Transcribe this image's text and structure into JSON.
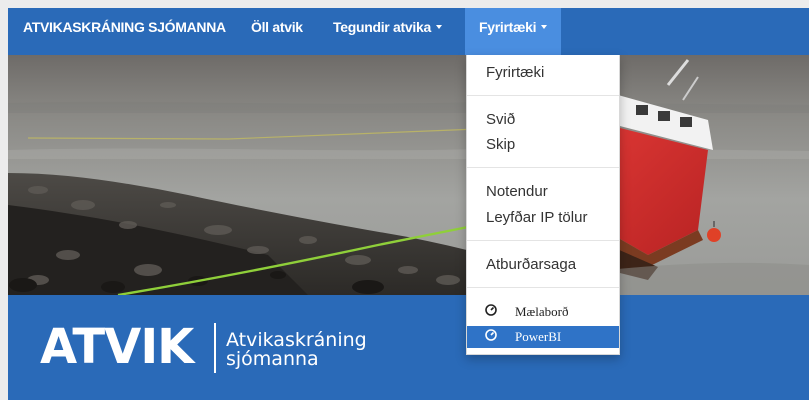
{
  "navbar": {
    "brand": "ATVIKASKRÁNING SJÓMANNA",
    "all_incidents": "Öll atvik",
    "incident_types": "Tegundir atvika",
    "companies": "Fyrirtæki"
  },
  "dropdown": {
    "items": [
      "Fyrirtæki",
      "Svið",
      "Skip",
      "Notendur",
      "Leyfðar IP tölur",
      "Atburðarsaga",
      "Mælaborð",
      "PowerBI"
    ],
    "active_item": "PowerBI"
  },
  "branding": {
    "logo": "ATVIK",
    "tagline_line1": "Atvikaskráning",
    "tagline_line2": "sjómanna"
  },
  "colors": {
    "navbar_bg": "#2a6ab8",
    "nav_active_bg": "#4a8ee0",
    "active_menu_bg": "#2f73c7",
    "boat_red": "#d62d2d"
  },
  "icons": {
    "caret": "chevron-down-icon",
    "dashboard": "gauge-icon",
    "powerbi": "gauge-icon"
  }
}
